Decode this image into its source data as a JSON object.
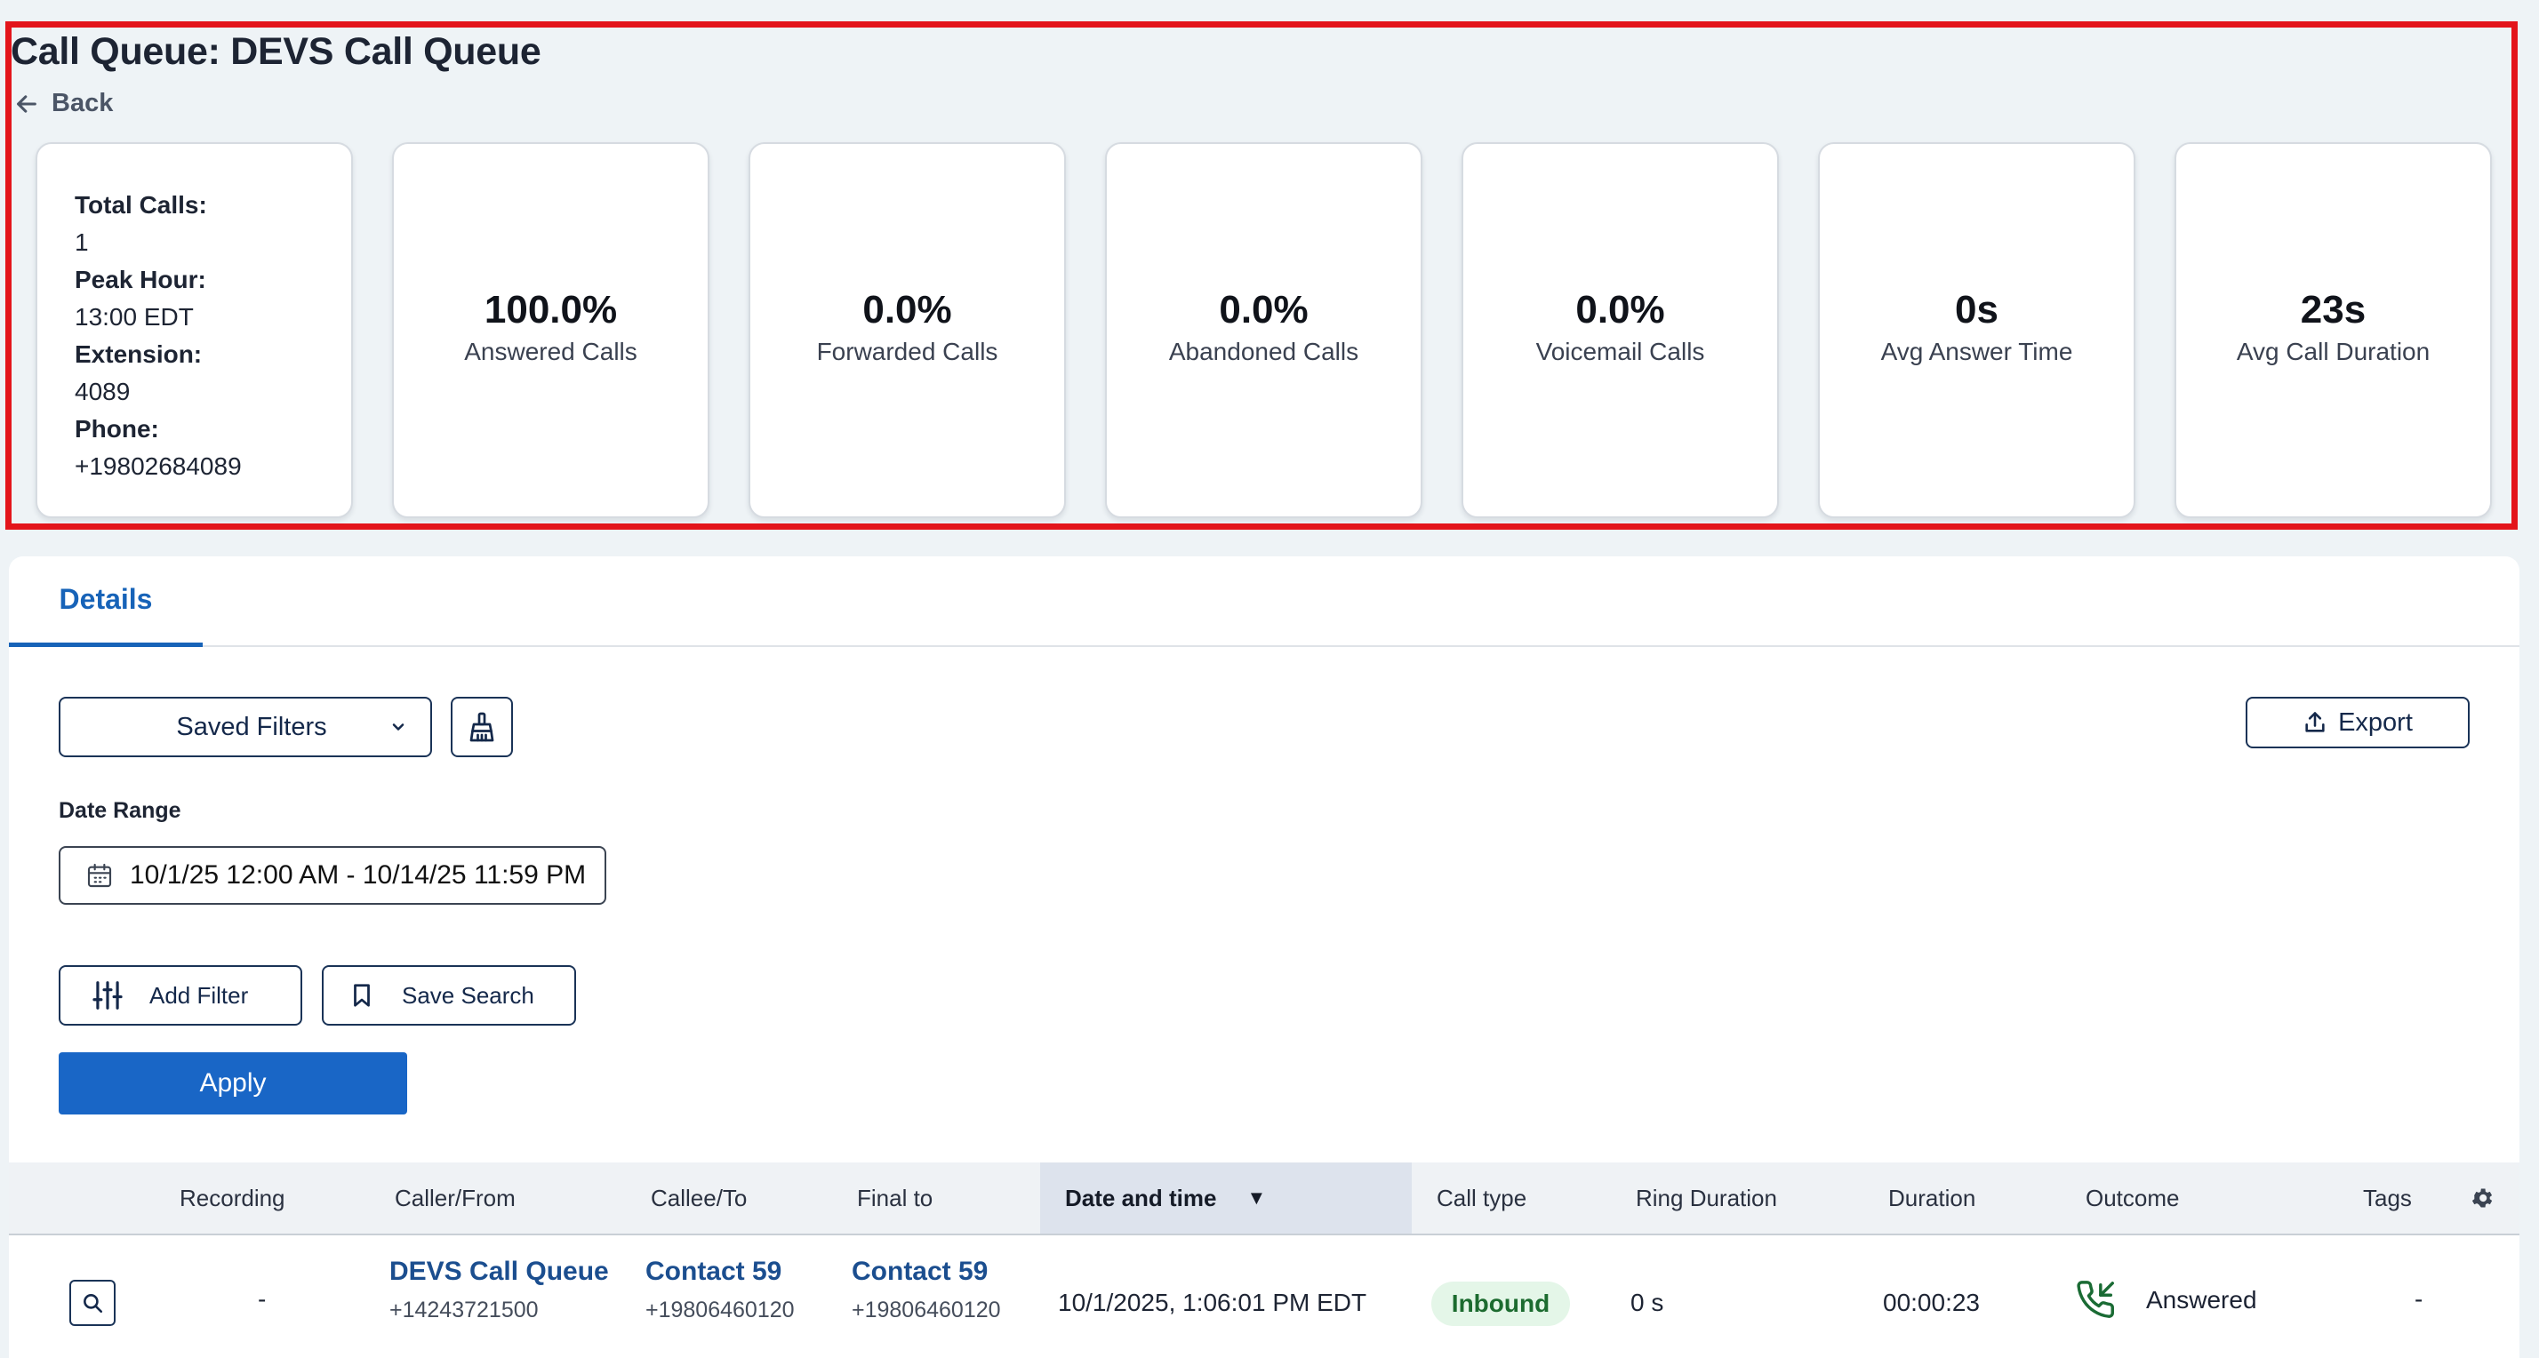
{
  "page": {
    "title": "Call Queue: DEVS Call Queue",
    "back_label": "Back"
  },
  "info_card": {
    "total_calls_label": "Total Calls:",
    "total_calls_value": "1",
    "peak_hour_label": "Peak Hour:",
    "peak_hour_value": "13:00 EDT",
    "extension_label": "Extension:",
    "extension_value": "4089",
    "phone_label": "Phone:",
    "phone_value": "+19802684089"
  },
  "stats": [
    {
      "value": "100.0%",
      "label": "Answered Calls"
    },
    {
      "value": "0.0%",
      "label": "Forwarded Calls"
    },
    {
      "value": "0.0%",
      "label": "Abandoned Calls"
    },
    {
      "value": "0.0%",
      "label": "Voicemail Calls"
    },
    {
      "value": "0s",
      "label": "Avg Answer Time"
    },
    {
      "value": "23s",
      "label": "Avg Call Duration"
    }
  ],
  "tabs": {
    "details": "Details"
  },
  "filters": {
    "saved_filters_label": "Saved Filters",
    "export_label": "Export",
    "date_range_label": "Date Range",
    "date_range_value": "10/1/25 12:00 AM - 10/14/25 11:59 PM",
    "add_filter_label": "Add Filter",
    "save_search_label": "Save Search",
    "apply_label": "Apply"
  },
  "table": {
    "columns": [
      "Recording",
      "Caller/From",
      "Callee/To",
      "Final to",
      "Date and time",
      "Call type",
      "Ring Duration",
      "Duration",
      "Outcome",
      "Tags"
    ],
    "sorted_indicator": "▼",
    "rows": [
      {
        "recording": "-",
        "caller_name": "DEVS Call Queue",
        "caller_number": "+14243721500",
        "callee_name": "Contact 59",
        "callee_number": "+19806460120",
        "final_name": "Contact 59",
        "final_number": "+19806460120",
        "datetime": "10/1/2025, 1:06:01 PM EDT",
        "call_type": "Inbound",
        "ring_duration": "0 s",
        "duration": "00:00:23",
        "outcome": "Answered",
        "tags": "-"
      }
    ]
  },
  "colors": {
    "accent": "#1763b8",
    "highlight": "#e3151b",
    "badge_bg": "#e4f6e8",
    "badge_text": "#1c6b2f"
  }
}
